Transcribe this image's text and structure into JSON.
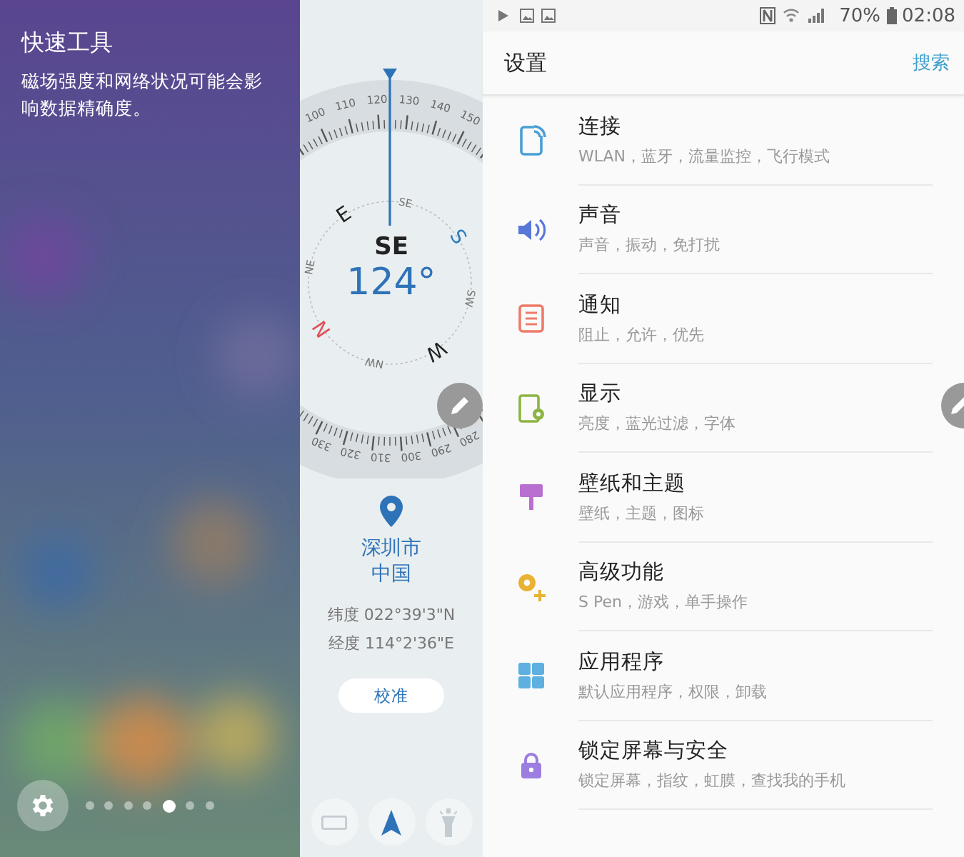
{
  "quick_tools": {
    "title": "快速工具",
    "description": "磁场强度和网络状况可能会影响数据精确度。",
    "page_dots": [
      {
        "selected": false
      },
      {
        "selected": false
      },
      {
        "selected": false
      },
      {
        "selected": false
      },
      {
        "selected": true
      },
      {
        "selected": false
      },
      {
        "selected": false
      }
    ]
  },
  "compass": {
    "dial_top_labels": [
      "100",
      "110",
      "120",
      "130",
      "140",
      "150"
    ],
    "dial_bottom_labels": [
      "330",
      "320",
      "310",
      "300",
      "290",
      "280"
    ],
    "directions": [
      {
        "label": "SE",
        "kind": "intercardinal",
        "color": "#777777"
      },
      {
        "label": "S",
        "kind": "cardinal",
        "color": "#2a7fc0"
      },
      {
        "label": "SW",
        "kind": "intercardinal",
        "color": "#777777"
      },
      {
        "label": "W",
        "kind": "cardinal",
        "color": "#222222"
      },
      {
        "label": "NW",
        "kind": "intercardinal",
        "color": "#777777"
      },
      {
        "label": "N",
        "kind": "cardinal",
        "color": "#e0505a"
      },
      {
        "label": "NE",
        "kind": "intercardinal",
        "color": "#777777"
      },
      {
        "label": "E",
        "kind": "cardinal",
        "color": "#222222"
      }
    ],
    "heading": "SE",
    "degrees": "124°",
    "city": "深圳市",
    "country": "中国",
    "latitude": "纬度 022°39'3\"N",
    "longitude": "经度 114°2'36\"E",
    "calibrate_button": "校准"
  },
  "status_bar": {
    "battery": "70%",
    "time": "02:08"
  },
  "settings": {
    "title": "设置",
    "search": "搜索",
    "items": [
      {
        "kind": "connections",
        "color": "#4a9fd6",
        "title": "连接",
        "subtitle": "WLAN，蓝牙，流量监控，飞行模式"
      },
      {
        "kind": "sound",
        "color": "#5878d8",
        "title": "声音",
        "subtitle": "声音，振动，免打扰"
      },
      {
        "kind": "notifications",
        "color": "#ef7a6a",
        "title": "通知",
        "subtitle": "阻止，允许，优先"
      },
      {
        "kind": "display",
        "color": "#8cb443",
        "title": "显示",
        "subtitle": "亮度，蓝光过滤，字体"
      },
      {
        "kind": "wallpaper",
        "color": "#b86fcf",
        "title": "壁纸和主题",
        "subtitle": "壁纸，主题，图标"
      },
      {
        "kind": "advanced",
        "color": "#e9b234",
        "title": "高级功能",
        "subtitle": "S Pen，游戏，单手操作"
      },
      {
        "kind": "apps",
        "color": "#5db0e0",
        "title": "应用程序",
        "subtitle": "默认应用程序，权限，卸载"
      },
      {
        "kind": "lock",
        "color": "#9b7ee0",
        "title": "锁定屏幕与安全",
        "subtitle": "锁定屏幕，指纹，虹膜，查找我的手机"
      }
    ]
  }
}
